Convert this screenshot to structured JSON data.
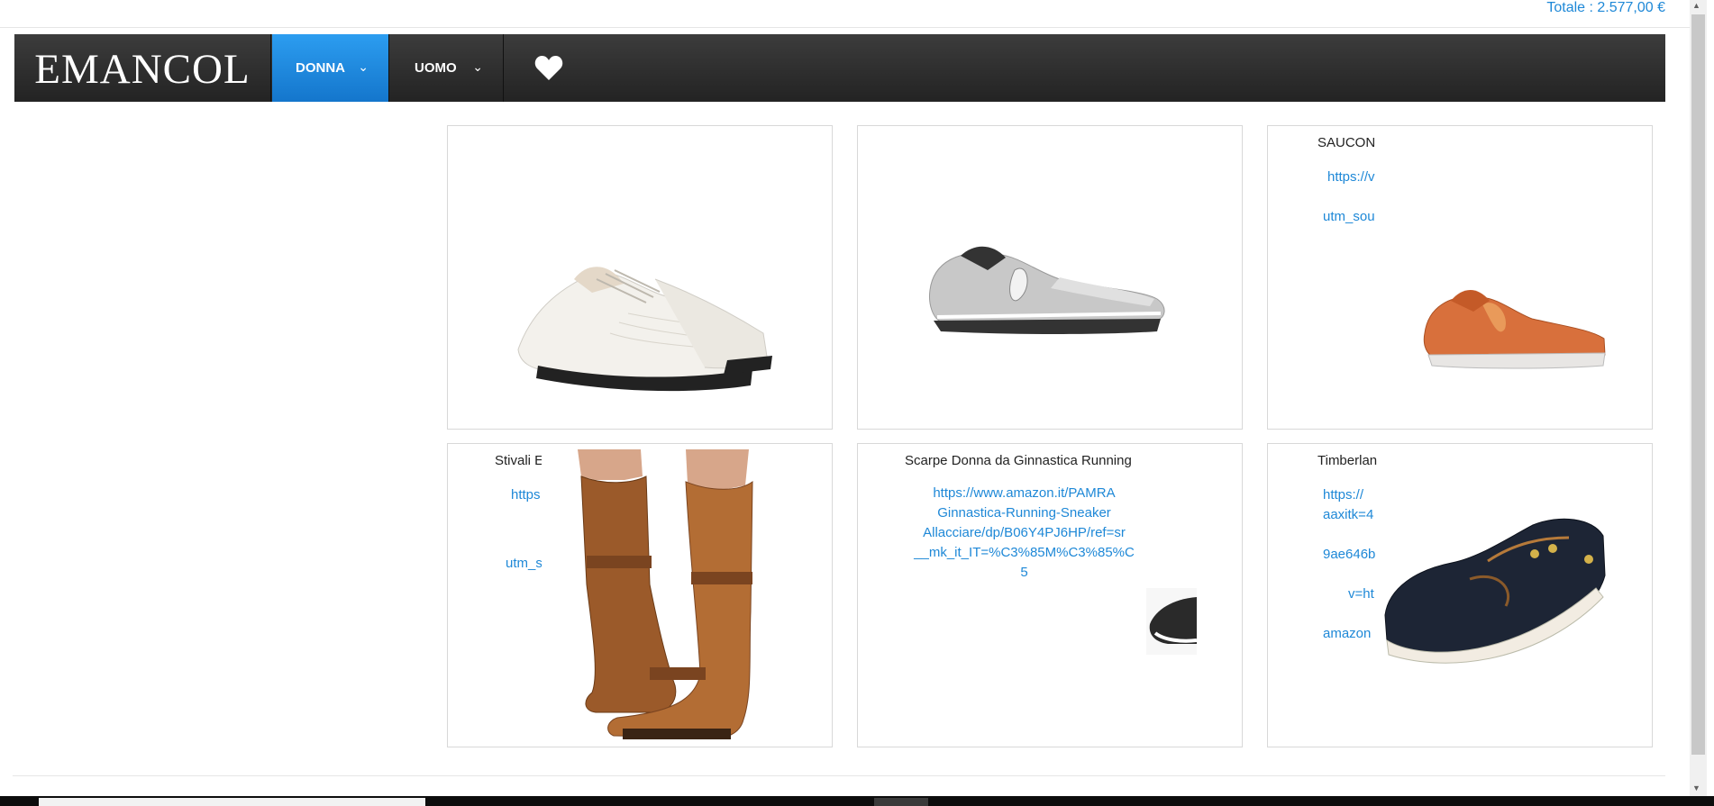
{
  "header": {
    "total": "Totale : 2.577,00 €"
  },
  "navbar": {
    "logo": "EMANCOL",
    "items": [
      {
        "label": "DONNA"
      },
      {
        "label": "UOMO"
      }
    ],
    "chevron": "⌄",
    "heart_icon": "heart-icon"
  },
  "products": [
    {
      "image": "white-sneakers"
    },
    {
      "image": "silver-saucony-sneaker"
    },
    {
      "title": "SAUCON",
      "links": [
        "https://v",
        "utm_sou"
      ],
      "image": "orange-saucony-sneaker"
    },
    {
      "title": "Stivali E",
      "links": [
        "https",
        "utm_s"
      ],
      "image": "tan-leather-boots"
    },
    {
      "title": "Scarpe Donna da Ginnastica Running",
      "link_lines": [
        "https://www.amazon.it/PAMRA",
        "Ginnastica-Running-Sneaker",
        "Allacciare/dp/B06Y4PJ6HP/ref=sr",
        "__mk_it_IT=%C3%85M%C3%85%C",
        "5"
      ],
      "image": "black-sneaker-partial"
    },
    {
      "title": "Timberlan",
      "links": [
        "https://",
        "aaxitk=4",
        "9ae646b",
        "v=ht",
        "amazon"
      ],
      "image": "navy-boat-shoe"
    }
  ],
  "colors": {
    "accent": "#1e88d7",
    "nav_active": "#1a8ae6",
    "nav_bg": "#2d2d2d"
  }
}
